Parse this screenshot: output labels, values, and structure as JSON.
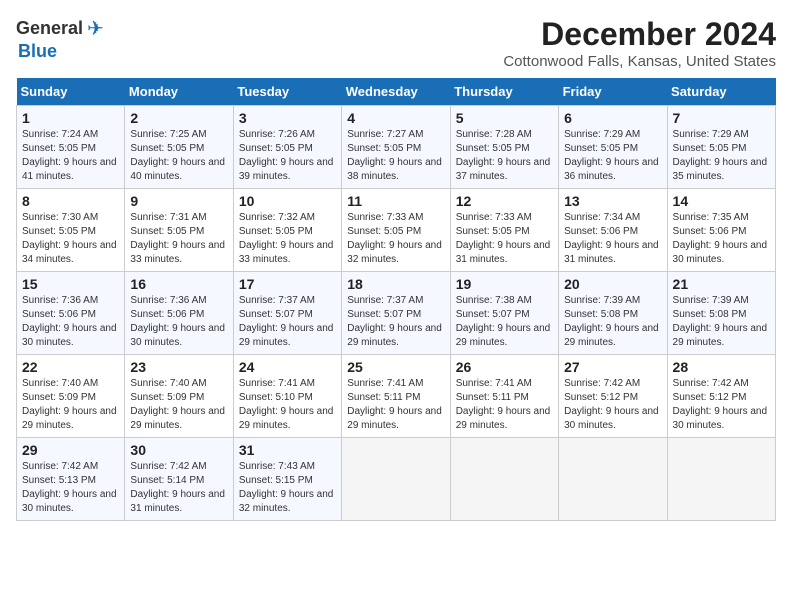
{
  "header": {
    "logo_line1": "General",
    "logo_line2": "Blue",
    "title": "December 2024",
    "subtitle": "Cottonwood Falls, Kansas, United States"
  },
  "weekdays": [
    "Sunday",
    "Monday",
    "Tuesday",
    "Wednesday",
    "Thursday",
    "Friday",
    "Saturday"
  ],
  "weeks": [
    [
      {
        "day": "1",
        "sunrise": "Sunrise: 7:24 AM",
        "sunset": "Sunset: 5:05 PM",
        "daylight": "Daylight: 9 hours and 41 minutes."
      },
      {
        "day": "2",
        "sunrise": "Sunrise: 7:25 AM",
        "sunset": "Sunset: 5:05 PM",
        "daylight": "Daylight: 9 hours and 40 minutes."
      },
      {
        "day": "3",
        "sunrise": "Sunrise: 7:26 AM",
        "sunset": "Sunset: 5:05 PM",
        "daylight": "Daylight: 9 hours and 39 minutes."
      },
      {
        "day": "4",
        "sunrise": "Sunrise: 7:27 AM",
        "sunset": "Sunset: 5:05 PM",
        "daylight": "Daylight: 9 hours and 38 minutes."
      },
      {
        "day": "5",
        "sunrise": "Sunrise: 7:28 AM",
        "sunset": "Sunset: 5:05 PM",
        "daylight": "Daylight: 9 hours and 37 minutes."
      },
      {
        "day": "6",
        "sunrise": "Sunrise: 7:29 AM",
        "sunset": "Sunset: 5:05 PM",
        "daylight": "Daylight: 9 hours and 36 minutes."
      },
      {
        "day": "7",
        "sunrise": "Sunrise: 7:29 AM",
        "sunset": "Sunset: 5:05 PM",
        "daylight": "Daylight: 9 hours and 35 minutes."
      }
    ],
    [
      {
        "day": "8",
        "sunrise": "Sunrise: 7:30 AM",
        "sunset": "Sunset: 5:05 PM",
        "daylight": "Daylight: 9 hours and 34 minutes."
      },
      {
        "day": "9",
        "sunrise": "Sunrise: 7:31 AM",
        "sunset": "Sunset: 5:05 PM",
        "daylight": "Daylight: 9 hours and 33 minutes."
      },
      {
        "day": "10",
        "sunrise": "Sunrise: 7:32 AM",
        "sunset": "Sunset: 5:05 PM",
        "daylight": "Daylight: 9 hours and 33 minutes."
      },
      {
        "day": "11",
        "sunrise": "Sunrise: 7:33 AM",
        "sunset": "Sunset: 5:05 PM",
        "daylight": "Daylight: 9 hours and 32 minutes."
      },
      {
        "day": "12",
        "sunrise": "Sunrise: 7:33 AM",
        "sunset": "Sunset: 5:05 PM",
        "daylight": "Daylight: 9 hours and 31 minutes."
      },
      {
        "day": "13",
        "sunrise": "Sunrise: 7:34 AM",
        "sunset": "Sunset: 5:06 PM",
        "daylight": "Daylight: 9 hours and 31 minutes."
      },
      {
        "day": "14",
        "sunrise": "Sunrise: 7:35 AM",
        "sunset": "Sunset: 5:06 PM",
        "daylight": "Daylight: 9 hours and 30 minutes."
      }
    ],
    [
      {
        "day": "15",
        "sunrise": "Sunrise: 7:36 AM",
        "sunset": "Sunset: 5:06 PM",
        "daylight": "Daylight: 9 hours and 30 minutes."
      },
      {
        "day": "16",
        "sunrise": "Sunrise: 7:36 AM",
        "sunset": "Sunset: 5:06 PM",
        "daylight": "Daylight: 9 hours and 30 minutes."
      },
      {
        "day": "17",
        "sunrise": "Sunrise: 7:37 AM",
        "sunset": "Sunset: 5:07 PM",
        "daylight": "Daylight: 9 hours and 29 minutes."
      },
      {
        "day": "18",
        "sunrise": "Sunrise: 7:37 AM",
        "sunset": "Sunset: 5:07 PM",
        "daylight": "Daylight: 9 hours and 29 minutes."
      },
      {
        "day": "19",
        "sunrise": "Sunrise: 7:38 AM",
        "sunset": "Sunset: 5:07 PM",
        "daylight": "Daylight: 9 hours and 29 minutes."
      },
      {
        "day": "20",
        "sunrise": "Sunrise: 7:39 AM",
        "sunset": "Sunset: 5:08 PM",
        "daylight": "Daylight: 9 hours and 29 minutes."
      },
      {
        "day": "21",
        "sunrise": "Sunrise: 7:39 AM",
        "sunset": "Sunset: 5:08 PM",
        "daylight": "Daylight: 9 hours and 29 minutes."
      }
    ],
    [
      {
        "day": "22",
        "sunrise": "Sunrise: 7:40 AM",
        "sunset": "Sunset: 5:09 PM",
        "daylight": "Daylight: 9 hours and 29 minutes."
      },
      {
        "day": "23",
        "sunrise": "Sunrise: 7:40 AM",
        "sunset": "Sunset: 5:09 PM",
        "daylight": "Daylight: 9 hours and 29 minutes."
      },
      {
        "day": "24",
        "sunrise": "Sunrise: 7:41 AM",
        "sunset": "Sunset: 5:10 PM",
        "daylight": "Daylight: 9 hours and 29 minutes."
      },
      {
        "day": "25",
        "sunrise": "Sunrise: 7:41 AM",
        "sunset": "Sunset: 5:11 PM",
        "daylight": "Daylight: 9 hours and 29 minutes."
      },
      {
        "day": "26",
        "sunrise": "Sunrise: 7:41 AM",
        "sunset": "Sunset: 5:11 PM",
        "daylight": "Daylight: 9 hours and 29 minutes."
      },
      {
        "day": "27",
        "sunrise": "Sunrise: 7:42 AM",
        "sunset": "Sunset: 5:12 PM",
        "daylight": "Daylight: 9 hours and 30 minutes."
      },
      {
        "day": "28",
        "sunrise": "Sunrise: 7:42 AM",
        "sunset": "Sunset: 5:12 PM",
        "daylight": "Daylight: 9 hours and 30 minutes."
      }
    ],
    [
      {
        "day": "29",
        "sunrise": "Sunrise: 7:42 AM",
        "sunset": "Sunset: 5:13 PM",
        "daylight": "Daylight: 9 hours and 30 minutes."
      },
      {
        "day": "30",
        "sunrise": "Sunrise: 7:42 AM",
        "sunset": "Sunset: 5:14 PM",
        "daylight": "Daylight: 9 hours and 31 minutes."
      },
      {
        "day": "31",
        "sunrise": "Sunrise: 7:43 AM",
        "sunset": "Sunset: 5:15 PM",
        "daylight": "Daylight: 9 hours and 32 minutes."
      },
      null,
      null,
      null,
      null
    ]
  ]
}
